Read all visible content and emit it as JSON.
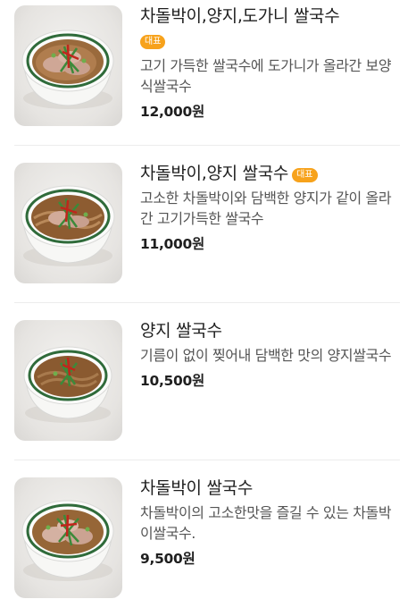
{
  "menu": {
    "items": [
      {
        "name": "차돌박이,양지,도가니 쌀국수",
        "badge": "대표",
        "description": "고기 가득한 쌀국수에 도가니가 올라간 보양식쌀국수",
        "price": "12,000원",
        "image_icon": "pho-bowl-brisket-icon"
      },
      {
        "name": "차돌박이,양지 쌀국수",
        "badge": "대표",
        "description": "고소한 차돌박이와 담백한 양지가 같이 올라간 고기가득한 쌀국수",
        "price": "11,000원",
        "image_icon": "pho-bowl-brisket-icon"
      },
      {
        "name": "양지 쌀국수",
        "description": "기름이 없이 찢어내 담백한 맛의 양지쌀국수",
        "price": "10,500원",
        "image_icon": "pho-bowl-icon"
      },
      {
        "name": "차돌박이 쌀국수",
        "description": "차돌박이의 고소한맛을 즐길 수 있는 차돌박이쌀국수.",
        "price": "9,500원",
        "image_icon": "pho-bowl-brisket-icon"
      }
    ],
    "badge_color": "#f7a21b"
  }
}
